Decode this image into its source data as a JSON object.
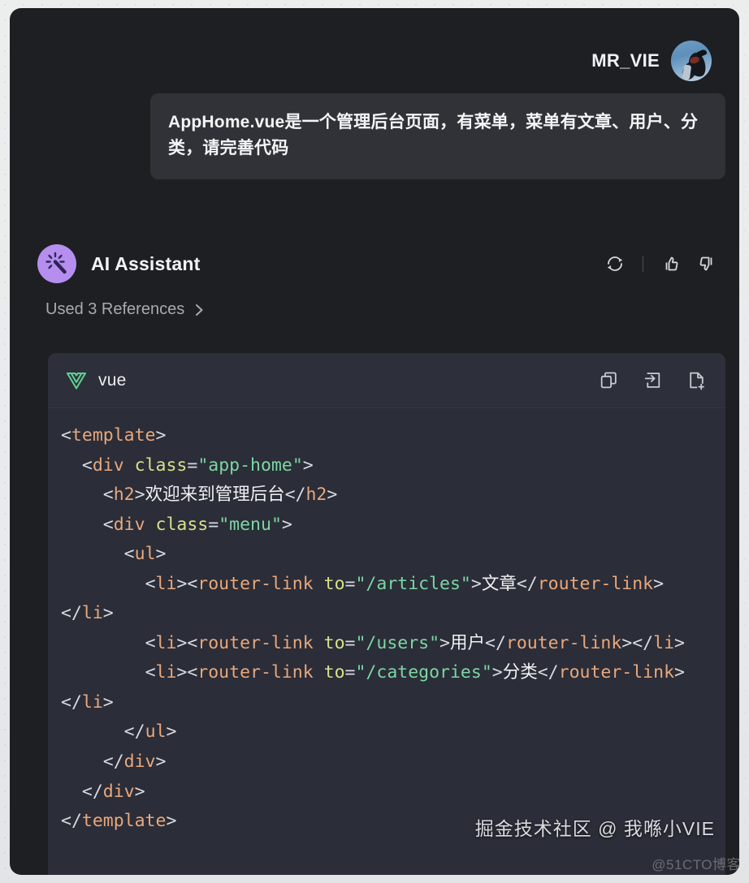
{
  "user": {
    "name": "MR_VIE",
    "avatar_icon": "bird-photo-avatar",
    "message": "AppHome.vue是一个管理后台页面，有菜单，菜单有文章、用户、分类，请完善代码"
  },
  "assistant": {
    "name": "AI Assistant",
    "avatar_icon": "magic-wand-sparkle-icon",
    "actions": [
      {
        "name": "regenerate-icon",
        "label": "Regenerate"
      },
      {
        "name": "thumbs-up-icon",
        "label": "Good response"
      },
      {
        "name": "thumbs-down-icon",
        "label": "Bad response"
      }
    ],
    "references_label": "Used 3 References",
    "references_chevron": "›"
  },
  "code_block": {
    "language_label": "vue",
    "language_icon": "vue-logo-icon",
    "actions": [
      {
        "name": "copy-icon",
        "label": "Copy"
      },
      {
        "name": "insert-at-cursor-icon",
        "label": "Insert at caret"
      },
      {
        "name": "new-file-icon",
        "label": "Create new file"
      }
    ],
    "lines": [
      [
        {
          "t": "punct",
          "v": "<"
        },
        {
          "t": "tag",
          "v": "template"
        },
        {
          "t": "punct",
          "v": ">"
        }
      ],
      [
        {
          "t": "punct",
          "v": "  <"
        },
        {
          "t": "tag",
          "v": "div"
        },
        {
          "t": "punct",
          "v": " "
        },
        {
          "t": "attr",
          "v": "class"
        },
        {
          "t": "punct",
          "v": "="
        },
        {
          "t": "str",
          "v": "\"app-home\""
        },
        {
          "t": "punct",
          "v": ">"
        }
      ],
      [
        {
          "t": "punct",
          "v": "    <"
        },
        {
          "t": "tag",
          "v": "h2"
        },
        {
          "t": "punct",
          "v": ">"
        },
        {
          "t": "text",
          "v": "欢迎来到管理后台"
        },
        {
          "t": "punct",
          "v": "</"
        },
        {
          "t": "tag",
          "v": "h2"
        },
        {
          "t": "punct",
          "v": ">"
        }
      ],
      [
        {
          "t": "punct",
          "v": "    <"
        },
        {
          "t": "tag",
          "v": "div"
        },
        {
          "t": "punct",
          "v": " "
        },
        {
          "t": "attr",
          "v": "class"
        },
        {
          "t": "punct",
          "v": "="
        },
        {
          "t": "str",
          "v": "\"menu\""
        },
        {
          "t": "punct",
          "v": ">"
        }
      ],
      [
        {
          "t": "punct",
          "v": "      <"
        },
        {
          "t": "tag",
          "v": "ul"
        },
        {
          "t": "punct",
          "v": ">"
        }
      ],
      [
        {
          "t": "punct",
          "v": "        <"
        },
        {
          "t": "tag",
          "v": "li"
        },
        {
          "t": "punct",
          "v": "><"
        },
        {
          "t": "tag",
          "v": "router-link"
        },
        {
          "t": "punct",
          "v": " "
        },
        {
          "t": "attr",
          "v": "to"
        },
        {
          "t": "punct",
          "v": "="
        },
        {
          "t": "str",
          "v": "\"/articles\""
        },
        {
          "t": "punct",
          "v": ">"
        },
        {
          "t": "text",
          "v": "文章"
        },
        {
          "t": "punct",
          "v": "</"
        },
        {
          "t": "tag",
          "v": "router-link"
        },
        {
          "t": "punct",
          "v": "></"
        },
        {
          "t": "tag",
          "v": "li"
        },
        {
          "t": "punct",
          "v": ">"
        }
      ],
      [
        {
          "t": "punct",
          "v": "        <"
        },
        {
          "t": "tag",
          "v": "li"
        },
        {
          "t": "punct",
          "v": "><"
        },
        {
          "t": "tag",
          "v": "router-link"
        },
        {
          "t": "punct",
          "v": " "
        },
        {
          "t": "attr",
          "v": "to"
        },
        {
          "t": "punct",
          "v": "="
        },
        {
          "t": "str",
          "v": "\"/users\""
        },
        {
          "t": "punct",
          "v": ">"
        },
        {
          "t": "text",
          "v": "用户"
        },
        {
          "t": "punct",
          "v": "</"
        },
        {
          "t": "tag",
          "v": "router-link"
        },
        {
          "t": "punct",
          "v": "></"
        },
        {
          "t": "tag",
          "v": "li"
        },
        {
          "t": "punct",
          "v": ">"
        }
      ],
      [
        {
          "t": "punct",
          "v": "        <"
        },
        {
          "t": "tag",
          "v": "li"
        },
        {
          "t": "punct",
          "v": "><"
        },
        {
          "t": "tag",
          "v": "router-link"
        },
        {
          "t": "punct",
          "v": " "
        },
        {
          "t": "attr",
          "v": "to"
        },
        {
          "t": "punct",
          "v": "="
        },
        {
          "t": "str",
          "v": "\"/categories\""
        },
        {
          "t": "punct",
          "v": ">"
        },
        {
          "t": "text",
          "v": "分类"
        },
        {
          "t": "punct",
          "v": "</"
        },
        {
          "t": "tag",
          "v": "router-link"
        },
        {
          "t": "punct",
          "v": "></"
        },
        {
          "t": "tag",
          "v": "li"
        },
        {
          "t": "punct",
          "v": ">"
        }
      ],
      [
        {
          "t": "punct",
          "v": "      </"
        },
        {
          "t": "tag",
          "v": "ul"
        },
        {
          "t": "punct",
          "v": ">"
        }
      ],
      [
        {
          "t": "punct",
          "v": "    </"
        },
        {
          "t": "tag",
          "v": "div"
        },
        {
          "t": "punct",
          "v": ">"
        }
      ],
      [
        {
          "t": "punct",
          "v": "  </"
        },
        {
          "t": "tag",
          "v": "div"
        },
        {
          "t": "punct",
          "v": ">"
        }
      ],
      [
        {
          "t": "punct",
          "v": "</"
        },
        {
          "t": "tag",
          "v": "template"
        },
        {
          "t": "punct",
          "v": ">"
        }
      ]
    ]
  },
  "watermarks": {
    "primary": "掘金技术社区 @ 我喺小VIE",
    "secondary": "@51CTO博客"
  },
  "colors": {
    "panel_bg": "#1e1f22",
    "bubble_bg": "#303237",
    "code_bg": "#2b2d38",
    "code_head_bg": "#2d2f3a",
    "ai_accent": "#b58ef0",
    "vue_green": "#5fcf94",
    "tag": "#e8a87c",
    "attr": "#d7e08a",
    "string": "#7bd7a2"
  }
}
